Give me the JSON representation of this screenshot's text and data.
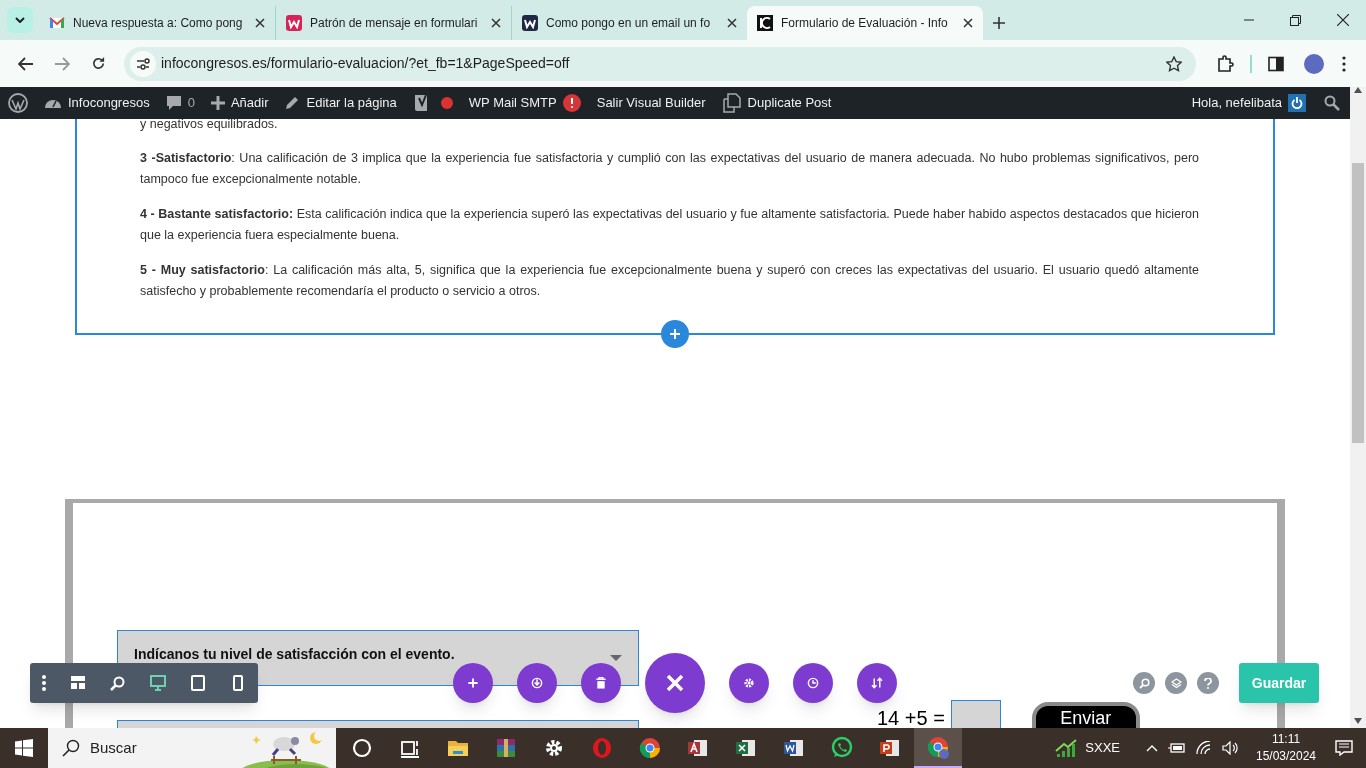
{
  "browser": {
    "tabs": [
      {
        "title": "Nueva respuesta a: Como pong",
        "kind": "gmail",
        "selected": false
      },
      {
        "title": "Patrón de mensaje en formulari",
        "kind": "w-pink",
        "selected": false
      },
      {
        "title": "Como pongo en un email un fo",
        "kind": "w-dark",
        "selected": false
      },
      {
        "title": "Formulario de Evaluación - Info",
        "kind": "ic",
        "selected": true
      }
    ],
    "url": "infocongresos.es/formulario-evaluacion/?et_fb=1&PageSpeed=off"
  },
  "admin_bar": {
    "items": [
      {
        "kind": "wp"
      },
      {
        "kind": "site",
        "label": "Infocongresos"
      },
      {
        "kind": "comments",
        "label": "0"
      },
      {
        "kind": "new",
        "label": "Añadir"
      },
      {
        "kind": "edit",
        "label": "Editar la página"
      },
      {
        "kind": "yoast"
      },
      {
        "kind": "smtp",
        "label": "WP Mail SMTP"
      },
      {
        "kind": "plain",
        "label": "Salir Visual Builder"
      },
      {
        "kind": "duplicate",
        "label": "Duplicate Post"
      }
    ],
    "greeting": "Hola, nefelibata"
  },
  "content": {
    "paragraphs": [
      "y negativos equilibrados.",
      "**3 -Satisfactorio**: Una calificación de 3 implica que la experiencia fue satisfactoria y cumplió con las expectativas del usuario de manera adecuada. No hubo problemas significativos, pero tampoco fue excepcionalmente notable.",
      "**4 - Bastante satisfactorio:** Esta calificación indica que la experiencia superó las expectativas del usuario y fue altamente satisfactoria. Puede haber habido aspectos destacados que hicieron que la experiencia fuera especialmente buena.",
      "**5 - Muy satisfactorio**: La calificación más alta, 5, significa que la experiencia fue excepcionalmente buena y superó con creces las expectativas del usuario. El usuario quedó altamente satisfecho y probablemente recomendaría el producto o servicio a otros."
    ]
  },
  "form": {
    "select": "Indícanos tu nivel de satisfacción con el evento.",
    "captcha": "14 +5 =",
    "submit": "Enviar"
  },
  "builder": {
    "view_modes": [
      {
        "kind": "wireframe",
        "selected": false
      },
      {
        "kind": "zoom",
        "selected": false
      },
      {
        "kind": "desktop",
        "selected": true
      },
      {
        "kind": "tablet",
        "selected": false
      },
      {
        "kind": "phone",
        "selected": false
      }
    ],
    "actions": [
      {
        "kind": "add"
      },
      {
        "kind": "portability"
      },
      {
        "kind": "delete"
      },
      {
        "kind": "close"
      },
      {
        "kind": "settings"
      },
      {
        "kind": "history"
      },
      {
        "kind": "sort"
      }
    ],
    "save": "Guardar"
  },
  "taskbar": {
    "search": "Buscar",
    "apps": [
      {
        "kind": "cortana",
        "selected": false
      },
      {
        "kind": "taskview",
        "selected": false
      },
      {
        "kind": "folder",
        "selected": false
      },
      {
        "kind": "archive",
        "selected": false
      },
      {
        "kind": "gear",
        "selected": false
      },
      {
        "kind": "opera",
        "selected": false
      },
      {
        "kind": "chrome",
        "selected": false
      },
      {
        "kind": "access",
        "selected": false
      },
      {
        "kind": "excel",
        "selected": false
      },
      {
        "kind": "word",
        "selected": false
      },
      {
        "kind": "whatsapp",
        "selected": false
      },
      {
        "kind": "powerpoint",
        "selected": false
      },
      {
        "kind": "chrome-profile",
        "selected": true
      }
    ],
    "stock": "SXXE",
    "time": "11:11",
    "date": "15/03/2024"
  }
}
